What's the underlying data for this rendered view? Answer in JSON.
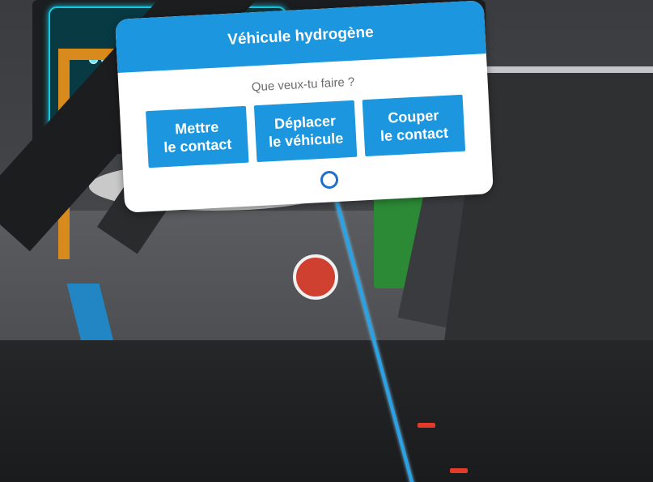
{
  "dialog": {
    "title": "Véhicule hydrogène",
    "question": "Que veux-tu faire ?",
    "buttons": [
      {
        "label": "Mettre\nle contact"
      },
      {
        "label": "Déplacer\nle véhicule"
      },
      {
        "label": "Couper\nle contact"
      }
    ]
  },
  "colors": {
    "accent": "#1c97df",
    "dialog_bg": "#ffffff",
    "laser": "#29a3e8"
  },
  "icons": {
    "pointer": "controller-pointer-icon"
  }
}
